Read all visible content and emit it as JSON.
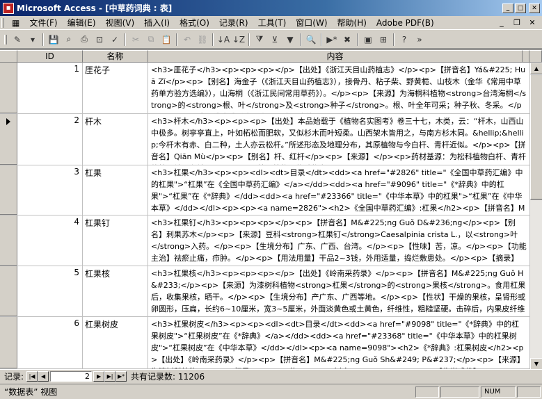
{
  "window": {
    "title": "Microsoft Access - [中草药词典 : 表]"
  },
  "menu": [
    {
      "label": "文件(F)"
    },
    {
      "label": "编辑(E)"
    },
    {
      "label": "视图(V)"
    },
    {
      "label": "插入(I)"
    },
    {
      "label": "格式(O)"
    },
    {
      "label": "记录(R)"
    },
    {
      "label": "工具(T)"
    },
    {
      "label": "窗口(W)"
    },
    {
      "label": "帮助(H)"
    },
    {
      "label": "Adobe PDF(B)"
    }
  ],
  "columns": {
    "id": "ID",
    "name": "名称",
    "content": "内容"
  },
  "rows": [
    {
      "id": "1",
      "name": "厓花子",
      "content": "<h3>厓花子</h3><p><p><p></p>【出处】《浙江天目山药植志》</p><p>【拼音名】Yá&#225; Huā Zǐ</p><p>【别名】海金子（《浙江天目山药植志》），接骨丹、粘子柴、野黄栀、山枝木（金华《常用中草药单方验方选编》），山海桐（《浙江民间常用草药》）。</p><p>【来源】为海桐科植物<strong>台湾海桐</strong>的<strong>根、叶</strong>及<strong>种子</strong>。根、叶全年可采；种子秋、冬采。</p><p>【原形态】灌木或乔木，高1~6米，全体无"
    },
    {
      "id": "2",
      "name": "杆木",
      "content": "<h3>杆木</h3><p><p><p>【出处】本品始载于《植物名实图考》卷三十七，木类，云：“杆木，山西山中极多。树亭亭直上，叶如柘松而肥软，又似杉木而叶短柔。山西架木皆用之，与南方杉木同。&hellip;&hellip;今杆木有赤、白二种，土人亦云松杆。”所述形态及地理分布，其原植物与今白杆、青杆近似。</p><p>【拼音名】Qiān Mù</p><p>【别名】杆、红杆</p><p>【来源】</p><p>药材基源：为松科植物白杆、青杆的枝干结节和针叶。</p><p>拉丁植物动物矿物名："
    },
    {
      "id": "3",
      "name": "杠果",
      "content": "<h3>杠果</h3><p><p><dl><dt>目录</dt><dd><a href=\"#2826\" title=\"《全国中草药汇编》中的杠果\">“杠果”在《全国中草药汇编》</a></dd><dd><a href=\"#9096\" title=\"《*辞典》中的杠果\">“杠果”在《*辞典》</dd><dd><a href=\"#23366\" title=\"《中华本草》中的杠果\">“杠果”在《中华本草》</dd></dl><p><p><a name=2826\"><h2>《全国中草药汇编》:杠果</h2><p>【拼音名】M&#225;ng Guǒ</p><p>【别名】马蒙、莽果、麻蒙果</p><p>【来源】漆树科杠果属植物<strong>"
    },
    {
      "id": "4",
      "name": "杠果钉",
      "content": "<h3>杠果钉</h3><p><p><p></p><p>【拼音名】M&#225;ng Guǒ D&#236;ng</p><p>【别名】刺果苏木</p><p>【来源】豆科<strong>杠果钉</strong>Caesalpinia crista L.，以<strong>叶</strong>入药。</p><p>【生境分布】广东、广西、台湾。</p><p>【性味】苦，凉。</p><p>【功能主治】祛瘀止痛，疖肿。</p><p>【用法用量】干品2~3钱，外用适量，捣烂敷患处。</p><p>【摘录】《全国中草药汇编》</p>"
    },
    {
      "id": "5",
      "name": "杠果核",
      "content": "<h3>杠果核</h3><p><p><p></p>【出处】《岭南采药录》</p><p>【拼音名】M&#225;ng Guǒ H&#233;</p><p>【来源】为漆树科植物<strong>杠果</strong>的<strong>果核</strong>。食用杠果后，收集果核，晒干。</p><p>【生境分布】产广东、广西等地。</p><p>【性状】干燥的果核，呈肾形或卵圆形，压扁，长约6~10厘米，宽3~5厘米，外面淡黄色或土黄色，纤维性，粗糙坚硬。击碎后，内果皮纤维状，内表面平滑，淡黄色，木质化。种皮纸质，类白色，子叶2片，肥厚，暗"
    },
    {
      "id": "6",
      "name": "杠果树皮",
      "content": "<h3>杠果树皮</h3><p><p><dl><dt>目录</dt><dd><a href=\"#9098\" title=\"《*辞典》中的杠果树皮\">“杠果树皮”在《*辞典》</a></dd><dd><a href=\"#23368\" title=\"《中华本草》中的杠果树皮\">“杠果树皮”在《中华本草》</dd></dl><p><a name=9098\"><h2>《*辞典》:杠果树皮</h2><p>【出处】《岭南采药录》</p><p>【拼音名】M&#225;ng Guǒ Sh&#249; P&#237;</p><p>【来源】为漆树科植物<strong>杠果</strong>的<strong>树皮</strong>。</p><p>【化学成份】"
    },
    {
      "id": "",
      "name": "",
      "content": ""
    }
  ],
  "navigation": {
    "label": "记录:",
    "current": "2",
    "total_label": "共有记录数: 11206"
  },
  "status": {
    "text": "“数据表” 视图",
    "num": "NUM"
  }
}
